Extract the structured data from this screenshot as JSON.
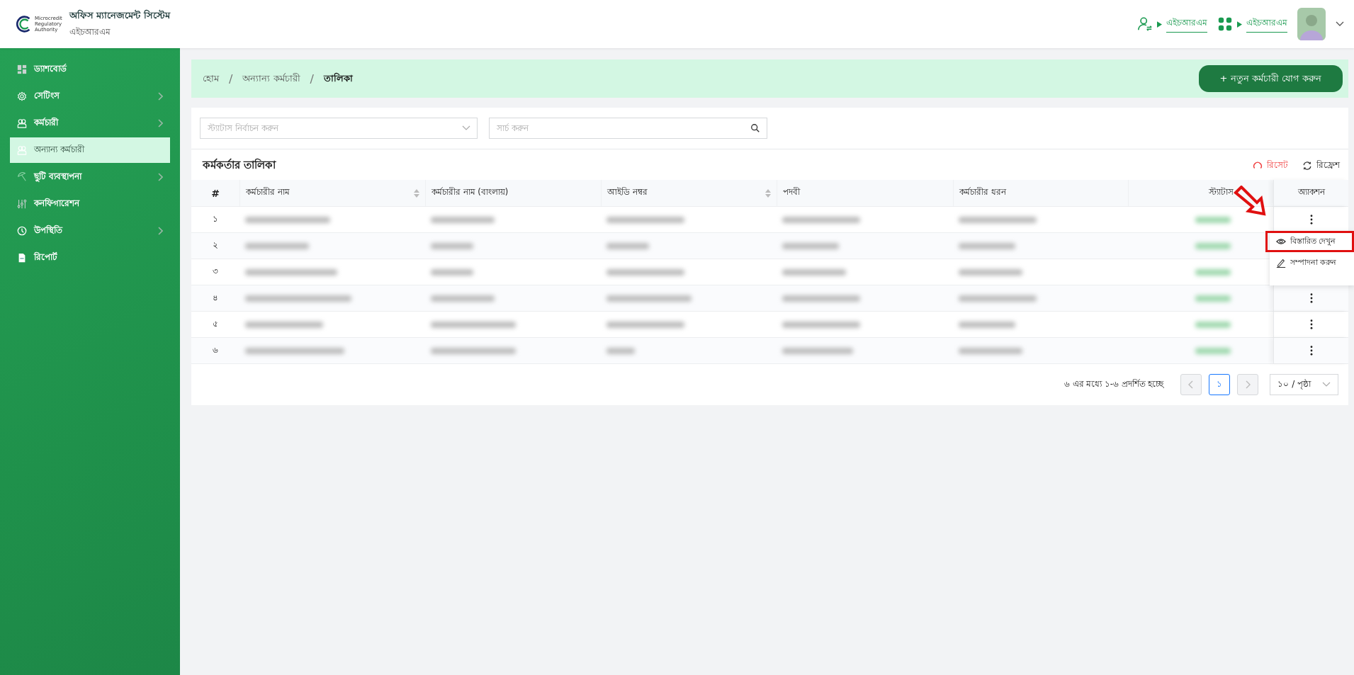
{
  "header": {
    "logo_text": [
      "Microcredit",
      "Regulatory",
      "Authority"
    ],
    "title": "অফিস ম্যানেজমেন্ট সিস্টেম",
    "subtitle": "এইচআরএম",
    "links": [
      {
        "kind": "user-switch",
        "label": "এইচআরএম"
      },
      {
        "kind": "grid",
        "label": "এইচআরএম"
      }
    ]
  },
  "sidebar": {
    "items": [
      {
        "kind": "dashboard",
        "label": "ড্যাশবোর্ড",
        "has_children": false,
        "selected": false
      },
      {
        "kind": "settings",
        "label": "সেটিংস",
        "has_children": true,
        "selected": false
      },
      {
        "kind": "people",
        "label": "কর্মচারী",
        "has_children": true,
        "selected": false
      },
      {
        "kind": "people",
        "label": "অন্যান্য কর্মচারী",
        "has_children": false,
        "selected": true
      },
      {
        "kind": "leave",
        "label": "ছুটি ব্যবস্থাপনা",
        "has_children": true,
        "selected": false
      },
      {
        "kind": "config",
        "label": "কনফিগারেশন",
        "has_children": false,
        "selected": false
      },
      {
        "kind": "attendance",
        "label": "উপস্থিতি",
        "has_children": true,
        "selected": false
      },
      {
        "kind": "report",
        "label": "রিপোর্ট",
        "has_children": false,
        "selected": false
      }
    ]
  },
  "breadcrumb": [
    {
      "kind": "link",
      "text": "হোম"
    },
    {
      "kind": "separator",
      "text": "/"
    },
    {
      "kind": "link",
      "text": "অন্যান্য কর্মচারী"
    },
    {
      "kind": "separator",
      "text": "/"
    },
    {
      "kind": "current",
      "text": "তালিকা"
    }
  ],
  "add_button": "+ নতুন কর্মচারী যোগ করুন",
  "filters": {
    "status": {
      "placeholder": "স্ট্যাটাস নির্বাচন করুন"
    },
    "search": {
      "placeholder": "সার্চ করুন"
    }
  },
  "table": {
    "title": "কর্মকর্তার তালিকা",
    "reset": "রিসেট",
    "refresh": "রিফ্রেশ",
    "columns": [
      {
        "label": "#",
        "sortable": false
      },
      {
        "label": "কর্মচারীর নাম",
        "sortable": true
      },
      {
        "label": "কর্মচারীর নাম (বাংলায়)",
        "sortable": false
      },
      {
        "label": "আইডি নম্বর",
        "sortable": true
      },
      {
        "label": "পদবী",
        "sortable": false
      },
      {
        "label": "কর্মচারীর ধরন",
        "sortable": false
      },
      {
        "label": "স্ট্যাটাস",
        "sortable": false
      },
      {
        "label": "অ্যাকশন",
        "sortable": false
      }
    ],
    "rows": [
      {
        "number": "১",
        "menu_button": true
      },
      {
        "number": "২",
        "menu_button": false
      },
      {
        "number": "৩",
        "menu_button": false
      },
      {
        "number": "৪",
        "menu_button": true
      },
      {
        "number": "৫",
        "menu_button": true
      },
      {
        "number": "৬",
        "menu_button": true
      }
    ]
  },
  "row_menu": [
    {
      "kind": "view",
      "label": "বিস্তারিত দেখুন",
      "highlighted": true
    },
    {
      "kind": "edit",
      "label": "সম্পাদনা করুন",
      "highlighted": false
    }
  ],
  "pagination": {
    "summary": "৬ এর মধ্যে ১-৬ প্রদর্শিত হচ্ছে",
    "pages": [
      {
        "label": "১",
        "selected": true
      }
    ],
    "page_size": "১০ / পৃষ্ঠা"
  }
}
